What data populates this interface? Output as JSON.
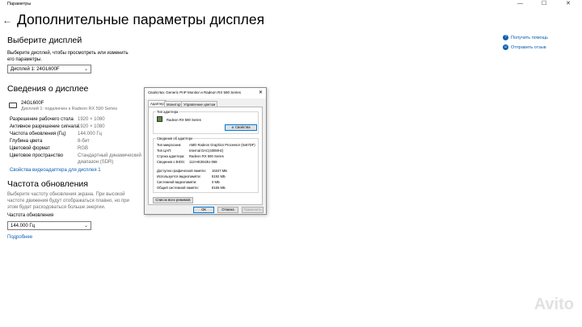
{
  "window": {
    "title": "Параметры",
    "minimize": "—",
    "maximize": "☐",
    "close": "✕"
  },
  "page_title": "Дополнительные параметры дисплея",
  "select_display": {
    "heading": "Выберите дисплей",
    "description": "Выберите дисплей, чтобы просмотреть или изменить его параметры.",
    "selected": "Дисплей 1: 24GL600F"
  },
  "display_info": {
    "heading": "Сведения о дисплее",
    "monitor_name": "24GL600F",
    "monitor_sub": "Дисплей 1: подключен к Radeon RX 590 Series",
    "rows": [
      {
        "label": "Разрешение рабочего стола",
        "value": "1920 × 1080"
      },
      {
        "label": "Активное разрешение сигнала",
        "value": "1920 × 1080"
      },
      {
        "label": "Частота обновления (Гц)",
        "value": "144.000 Гц"
      },
      {
        "label": "Глубина цвета",
        "value": "8-бит"
      },
      {
        "label": "Цветовой формат",
        "value": "RGB"
      },
      {
        "label": "Цветовое пространство",
        "value": "Стандартный динамический диапазон (SDR)"
      }
    ],
    "adapter_link": "Свойства видеоадаптера для дисплея 1"
  },
  "refresh": {
    "heading": "Частота обновления",
    "description": "Выберите частоту обновления экрана. При высокой частоте движения будут отображаться плавно, но при этом будет расходоваться больше энергии.",
    "label": "Частота обновления",
    "selected": "144.000 Гц",
    "more_link": "Подробнее"
  },
  "help": {
    "get_help": "Получить помощь",
    "feedback": "Отправить отзыв"
  },
  "dialog": {
    "title": "Свойства: Generic PnP Monitor и Radeon RX 590 Series",
    "close": "✕",
    "tabs": [
      "Адаптер",
      "Монитор",
      "Управление цветом"
    ],
    "adapter_type_title": "Тип адаптера",
    "adapter_name": "Radeon RX 590 Series",
    "properties_btn": "Свойства",
    "adapter_info_title": "Сведения об адаптере",
    "info_rows": [
      {
        "label": "Тип микросхем:",
        "value": "AMD Radeon Graphics Processor (0x67DF)"
      },
      {
        "label": "Тип ЦАП:",
        "value": "Internal DAC(400MHz)"
      },
      {
        "label": "Строка адаптера:",
        "value": "Radeon RX 590 Series"
      },
      {
        "label": "Сведения о BIOS:",
        "value": "113-HE3643U-068"
      }
    ],
    "memory_rows": [
      {
        "label": "Доступно графической памяти:",
        "value": "16347 МБ"
      },
      {
        "label": "Используется видеопамяти:",
        "value": "8192 МБ"
      },
      {
        "label": "Системной видеопамяти:",
        "value": "0 МБ"
      },
      {
        "label": "Общей системной памяти:",
        "value": "8155 МБ"
      }
    ],
    "modes_btn": "Список всех режимов",
    "ok": "ОК",
    "cancel": "Отмена",
    "apply": "Применить"
  },
  "watermark": "Avito"
}
